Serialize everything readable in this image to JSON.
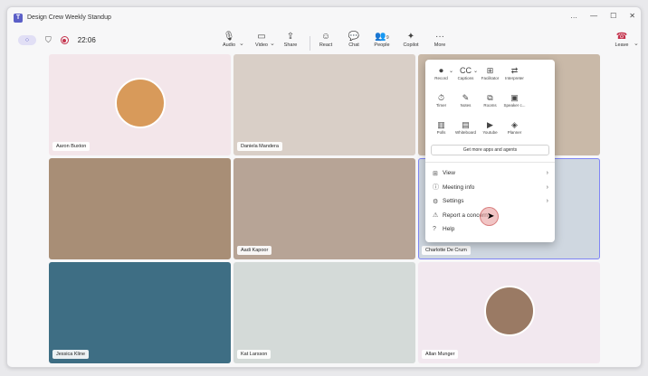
{
  "window": {
    "title": "Design Crew Weekly Standup",
    "controls": [
      "…",
      "—",
      "☐",
      "✕"
    ]
  },
  "toolbar": {
    "timer": "22:06",
    "buttons": [
      {
        "label": "Audio",
        "icon": "🎙"
      },
      {
        "label": "Video",
        "icon": "▭"
      },
      {
        "label": "Share",
        "icon": "⇪"
      },
      {
        "label": "React",
        "icon": "☺"
      },
      {
        "label": "Chat",
        "icon": "💬"
      },
      {
        "label": "People",
        "icon": "👥"
      },
      {
        "label": "Copilot",
        "icon": "✦"
      },
      {
        "label": "More",
        "icon": "···"
      }
    ],
    "people_count": "9",
    "leave": {
      "label": "Leave",
      "icon": "☎"
    }
  },
  "participants": [
    {
      "name": "Aaron Buxton",
      "bg": "#f3e6ea"
    },
    {
      "name": "Daniela Mandera",
      "bg": "#d9cfc7"
    },
    {
      "name": "",
      "bg": "#c9b9a8"
    },
    {
      "name": "",
      "bg": "#a88e76"
    },
    {
      "name": "Aadi Kapoor",
      "bg": "#b7a496"
    },
    {
      "name": "Charlotte De Crum",
      "bg": "#cfd7e0"
    },
    {
      "name": "Jessica Kline",
      "bg": "#3e6e84"
    },
    {
      "name": "Kat Larsson",
      "bg": "#d4dad8"
    },
    {
      "name": "Allan Munger",
      "bg": "#f2e8ef"
    }
  ],
  "more_menu": {
    "apps": [
      {
        "label": "Record",
        "icon": "⏺"
      },
      {
        "label": "Captions",
        "icon": "CC"
      },
      {
        "label": "Facilitator",
        "icon": "⊞"
      },
      {
        "label": "Interpreter",
        "icon": "⇄"
      },
      {
        "label": "Timer",
        "icon": "⏱"
      },
      {
        "label": "Notes",
        "icon": "✎"
      },
      {
        "label": "Rooms",
        "icon": "⧉"
      },
      {
        "label": "Speaker c...",
        "icon": "▣"
      },
      {
        "label": "Polls",
        "icon": "▥"
      },
      {
        "label": "Whiteboard",
        "icon": "▤"
      },
      {
        "label": "Youtube",
        "icon": "▶"
      },
      {
        "label": "Planner",
        "icon": "◈"
      }
    ],
    "get_more": "Get more apps and agents",
    "items": [
      {
        "label": "View",
        "icon": "⊞",
        "has_submenu": true
      },
      {
        "label": "Meeting info",
        "icon": "ⓘ",
        "has_submenu": true
      },
      {
        "label": "Settings",
        "icon": "⚙",
        "has_submenu": true
      },
      {
        "label": "Report a concern",
        "icon": "⚠",
        "has_submenu": false
      },
      {
        "label": "Help",
        "icon": "?",
        "has_submenu": false
      }
    ]
  }
}
